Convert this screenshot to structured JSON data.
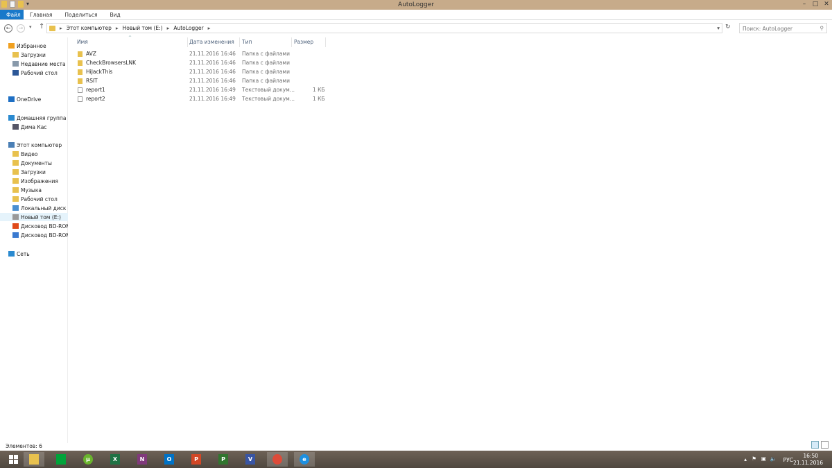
{
  "window": {
    "title": "AutoLogger",
    "minimize": "–",
    "maximize": "□",
    "close": "✕"
  },
  "ribbon": {
    "tabs": [
      "Файл",
      "Главная",
      "Поделиться",
      "Вид"
    ]
  },
  "address": {
    "crumbs": [
      "Этот компьютер",
      "Новый том (E:)",
      "AutoLogger"
    ],
    "search_placeholder": "Поиск: AutoLogger"
  },
  "sidebar": {
    "items": [
      {
        "label": "Избранное",
        "icon": "star-icon",
        "color": "#f0a020"
      },
      {
        "label": "Загрузки",
        "icon": "downloads-folder-icon",
        "color": "#e8c14e"
      },
      {
        "label": "Недавние места",
        "icon": "recent-places-icon",
        "color": "#8899aa"
      },
      {
        "label": "Рабочий стол",
        "icon": "desktop-icon",
        "color": "#2b5797"
      },
      {
        "label": "OneDrive",
        "icon": "onedrive-icon",
        "color": "#1e6fc4"
      },
      {
        "label": "Домашняя группа",
        "icon": "homegroup-icon",
        "color": "#2a8ad0"
      },
      {
        "label": "Дима Кас",
        "icon": "user-icon",
        "color": "#556"
      },
      {
        "label": "Этот компьютер",
        "icon": "computer-icon",
        "color": "#4a7fb5"
      },
      {
        "label": "Видео",
        "icon": "video-folder-icon",
        "color": "#e8c14e"
      },
      {
        "label": "Документы",
        "icon": "documents-folder-icon",
        "color": "#e8c14e"
      },
      {
        "label": "Загрузки",
        "icon": "downloads-folder-icon",
        "color": "#e8c14e"
      },
      {
        "label": "Изображения",
        "icon": "pictures-folder-icon",
        "color": "#e8c14e"
      },
      {
        "label": "Музыка",
        "icon": "music-folder-icon",
        "color": "#e8c14e"
      },
      {
        "label": "Рабочий стол",
        "icon": "desktop-folder-icon",
        "color": "#e8c14e"
      },
      {
        "label": "Локальный диск (C:)",
        "icon": "local-disk-icon",
        "color": "#4a8fd0"
      },
      {
        "label": "Новый том (E:)",
        "icon": "drive-icon",
        "color": "#999"
      },
      {
        "label": "Дисковод BD-ROM",
        "icon": "office-disc-icon",
        "color": "#e04a1a"
      },
      {
        "label": "Дисковод BD-ROM",
        "icon": "disc-drive-icon",
        "color": "#3a7ad0"
      },
      {
        "label": "Сеть",
        "icon": "network-icon",
        "color": "#2a8ad0"
      }
    ]
  },
  "columns": [
    "Имя",
    "Дата изменения",
    "Тип",
    "Размер"
  ],
  "files": [
    {
      "name": "AVZ",
      "date": "21.11.2016 16:46",
      "type": "Папка с файлами",
      "size": "",
      "kind": "folder"
    },
    {
      "name": "CheckBrowsersLNK",
      "date": "21.11.2016 16:46",
      "type": "Папка с файлами",
      "size": "",
      "kind": "folder"
    },
    {
      "name": "HiJackThis",
      "date": "21.11.2016 16:46",
      "type": "Папка с файлами",
      "size": "",
      "kind": "folder"
    },
    {
      "name": "RSIT",
      "date": "21.11.2016 16:46",
      "type": "Папка с файлами",
      "size": "",
      "kind": "folder"
    },
    {
      "name": "report1",
      "date": "21.11.2016 16:49",
      "type": "Текстовый докум...",
      "size": "1 КБ",
      "kind": "file"
    },
    {
      "name": "report2",
      "date": "21.11.2016 16:49",
      "type": "Текстовый докум...",
      "size": "1 КБ",
      "kind": "file"
    }
  ],
  "status": "Элементов: 6",
  "taskbar": {
    "apps": [
      {
        "name": "file-explorer",
        "label": "",
        "color": "#e8c14e"
      },
      {
        "name": "store",
        "label": "",
        "color": "#00a33a"
      },
      {
        "name": "utorrent",
        "label": "µ",
        "color": "#6ab42d"
      },
      {
        "name": "excel",
        "label": "X",
        "color": "#1f7244"
      },
      {
        "name": "onenote",
        "label": "N",
        "color": "#80397b"
      },
      {
        "name": "outlook",
        "label": "O",
        "color": "#0072c6"
      },
      {
        "name": "powerpoint",
        "label": "P",
        "color": "#d24726"
      },
      {
        "name": "project",
        "label": "P",
        "color": "#31752f"
      },
      {
        "name": "visio",
        "label": "V",
        "color": "#3955a3"
      },
      {
        "name": "chrome",
        "label": "",
        "color": "#dd4b39"
      },
      {
        "name": "internet-explorer",
        "label": "e",
        "color": "#1e90e0"
      }
    ],
    "lang": "РУС",
    "time": "16:50",
    "date": "21.11.2016"
  }
}
